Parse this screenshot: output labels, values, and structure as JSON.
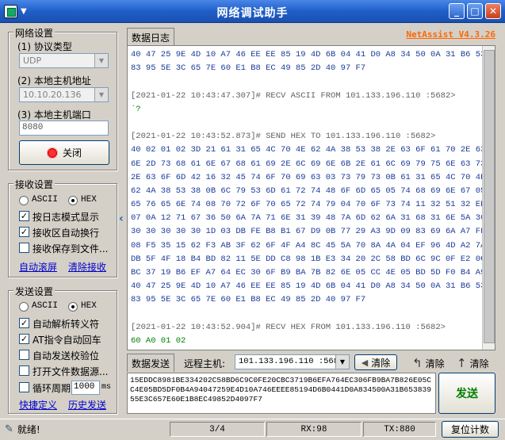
{
  "window": {
    "title": "网络调试助手",
    "brand": "NetAssist V4.3.26"
  },
  "net_settings": {
    "group_label": "网络设置",
    "protocol_label": "(1) 协议类型",
    "protocol_value": "UDP",
    "local_ip_label": "(2) 本地主机地址",
    "local_ip_value": "10.10.20.136",
    "local_port_label": "(3) 本地主机端口",
    "local_port_value": "8080",
    "close_button": "关闭"
  },
  "recv_settings": {
    "group_label": "接收设置",
    "ascii_label": "ASCII",
    "hex_label": "HEX",
    "log_mode_label": "按日志模式显示",
    "auto_wrap_label": "接收区自动换行",
    "save_file_label": "接收保存到文件...",
    "auto_scroll_link": "自动滚屏",
    "clear_recv_link": "清除接收"
  },
  "send_settings": {
    "group_label": "发送设置",
    "ascii_label": "ASCII",
    "hex_label": "HEX",
    "auto_parse_label": "自动解析转义符",
    "at_return_label": "AT指令自动回车",
    "auto_checksum_label": "自动发送校验位",
    "open_file_label": "打开文件数据源...",
    "cycle_label": "循环周期",
    "cycle_value": "1000",
    "cycle_unit": "ms",
    "shortcut_link": "快捷定义",
    "history_link": "历史发送"
  },
  "log": {
    "tab_label": "数据日志",
    "lines": [
      {
        "cls": "c-blue",
        "text": "40 47 25 9E 4D 10 A7 46 EE EE 85 19 4D 6B 04 41 D0 A8 34 50 0A 31 B6 53"
      },
      {
        "cls": "c-blue",
        "text": "83 95 5E 3C 65 7E 60 E1 B8 EC 49 85 2D 40 97 F7"
      },
      {
        "cls": "c-blue",
        "text": ""
      },
      {
        "cls": "c-gray",
        "text": "[2021-01-22 10:43:47.307]# RECV ASCII FROM 101.133.196.110 :5682>"
      },
      {
        "cls": "c-green",
        "text": "`?"
      },
      {
        "cls": "c-blue",
        "text": ""
      },
      {
        "cls": "c-gray",
        "text": "[2021-01-22 10:43:52.873]# SEND HEX TO 101.133.196.110 :5682>"
      },
      {
        "cls": "c-blue",
        "text": "40 02 01 02 3D 21 61 31 65 4C 70 4E 62 4A 38 53 38 2E 63 6F 61 70 2E 63"
      },
      {
        "cls": "c-blue",
        "text": "6E 2D 73 68 61 6E 67 68 61 69 2E 6C 69 6E 6B 2E 61 6C 69 79 75 6E 63 73"
      },
      {
        "cls": "c-blue",
        "text": "2E 63 6F 6D 42 16 32 45 74 6F 70 69 63 03 73 79 73 0B 61 31 65 4C 70 4E"
      },
      {
        "cls": "c-blue",
        "text": "62 4A 38 53 38 0B 6C 79 53 6D 61 72 74 48 6F 6D 65 05 74 68 69 6E 67 05"
      },
      {
        "cls": "c-blue",
        "text": "65 76 65 6E 74 08 70 72 6F 70 65 72 74 79 04 70 6F 73 74 11 32 51 32 ED"
      },
      {
        "cls": "c-blue",
        "text": "07 0A 12 71 67 36 50 6A 7A 71 6E 31 39 48 7A 6D 62 6A 31 68 31 6E 5A 30"
      },
      {
        "cls": "c-blue",
        "text": "30 30 30 30 30 1D 03 DB FE B8 B1 67 D9 0B 77 29 A3 9D 09 83 69 6A A7 FF"
      },
      {
        "cls": "c-blue",
        "text": "08 F5 35 15 62 F3 AB 3F 62 6F 4F A4 8C 45 5A 70 8A 4A 04 EF 96 4D A2 7A"
      },
      {
        "cls": "c-blue",
        "text": "DB 5F 4F 18 B4 BD 82 11 5E DD C8 98 1B E3 34 20 2C 58 BD 6C 9C 0F E2 0C"
      },
      {
        "cls": "c-blue",
        "text": "BC 37 19 B6 EF A7 64 EC 30 6F B9 BA 7B 82 6E 05 CC 4E 05 BD 5D F0 B4 A9"
      },
      {
        "cls": "c-blue",
        "text": "40 47 25 9E 4D 10 A7 46 EE EE 85 19 4D 6B 04 41 D0 A8 34 50 0A 31 B6 53"
      },
      {
        "cls": "c-blue",
        "text": "83 95 5E 3C 65 7E 60 E1 B8 EC 49 85 2D 40 97 F7"
      },
      {
        "cls": "c-blue",
        "text": ""
      },
      {
        "cls": "c-gray",
        "text": "[2021-01-22 10:43:52.904]# RECV HEX FROM 101.133.196.110 :5682>"
      },
      {
        "cls": "c-green",
        "text": "60 A0 01 02"
      }
    ]
  },
  "send_bar": {
    "tab_label": "数据发送",
    "remote_label": "远程主机:",
    "remote_value": "101.133.196.110 :5682",
    "clear1": "清除",
    "clear2": "清除",
    "clear3": "清除",
    "send_text": "15EDDC8981BE334202C58BD6C9C0FE20CBC3719B6EFA764EC306FB9BA7B826E05CC4E05BD5DF0B4A94047259E4D10A746EEEE85194D6B0441D0A834500A31B65383955E3C657E60E1B8EC49852D4097F7",
    "send_button": "发送"
  },
  "status": {
    "ready": "就绪!",
    "pages": "3/4",
    "rx": "RX:98",
    "tx": "TX:880",
    "reset": "复位计数"
  }
}
